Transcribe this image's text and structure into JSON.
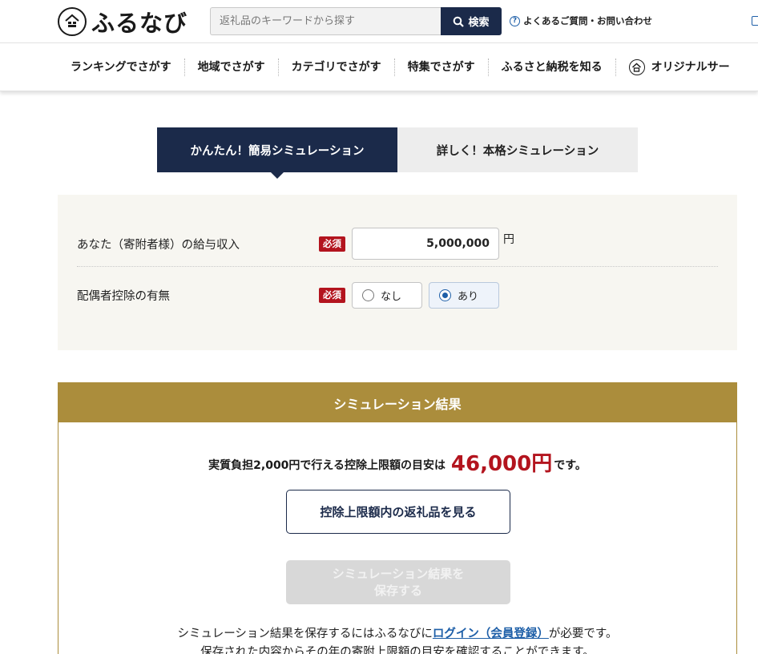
{
  "header": {
    "logo_text": "ふるなび",
    "search": {
      "placeholder": "返礼品のキーワードから探す",
      "button_label": "検索"
    },
    "faq_link": "よくあるご質問・お問い合わせ"
  },
  "nav": {
    "items": [
      "ランキングでさがす",
      "地域でさがす",
      "カテゴリでさがす",
      "特集でさがす",
      "ふるさと納税を知る",
      "オリジナルサー"
    ]
  },
  "tabs": {
    "simple": "かんたん！簡易シミュレーション",
    "detailed": "詳しく！本格シミュレーション"
  },
  "form": {
    "salary": {
      "label": "あなた（寄附者様）の給与収入",
      "required": "必須",
      "value": "5,000,000",
      "unit": "円"
    },
    "spouse": {
      "label": "配偶者控除の有無",
      "required": "必須",
      "option_no": "なし",
      "option_yes": "あり",
      "selected": "あり"
    }
  },
  "result": {
    "title": "シミュレーション結果",
    "line_prefix": "実質負担2,000円で行える控除上限額の目安は",
    "amount": "46,000円",
    "line_suffix": "です。",
    "see_button": "控除上限額内の返礼品を見る",
    "save_button_line1": "シミュレーション結果を",
    "save_button_line2": "保存する",
    "note_prefix": "シミュレーション結果を保存するにはふるなびに",
    "note_link": "ログイン（会員登録）",
    "note_suffix": "が必要です。",
    "note_line2": "保存された内容からその年の寄附上限額の目安を確認することができます。"
  },
  "colors": {
    "navy": "#1b2a4a",
    "gold": "#ab8d3c",
    "required_red": "#b3141e",
    "link_blue": "#1e5fa8"
  }
}
